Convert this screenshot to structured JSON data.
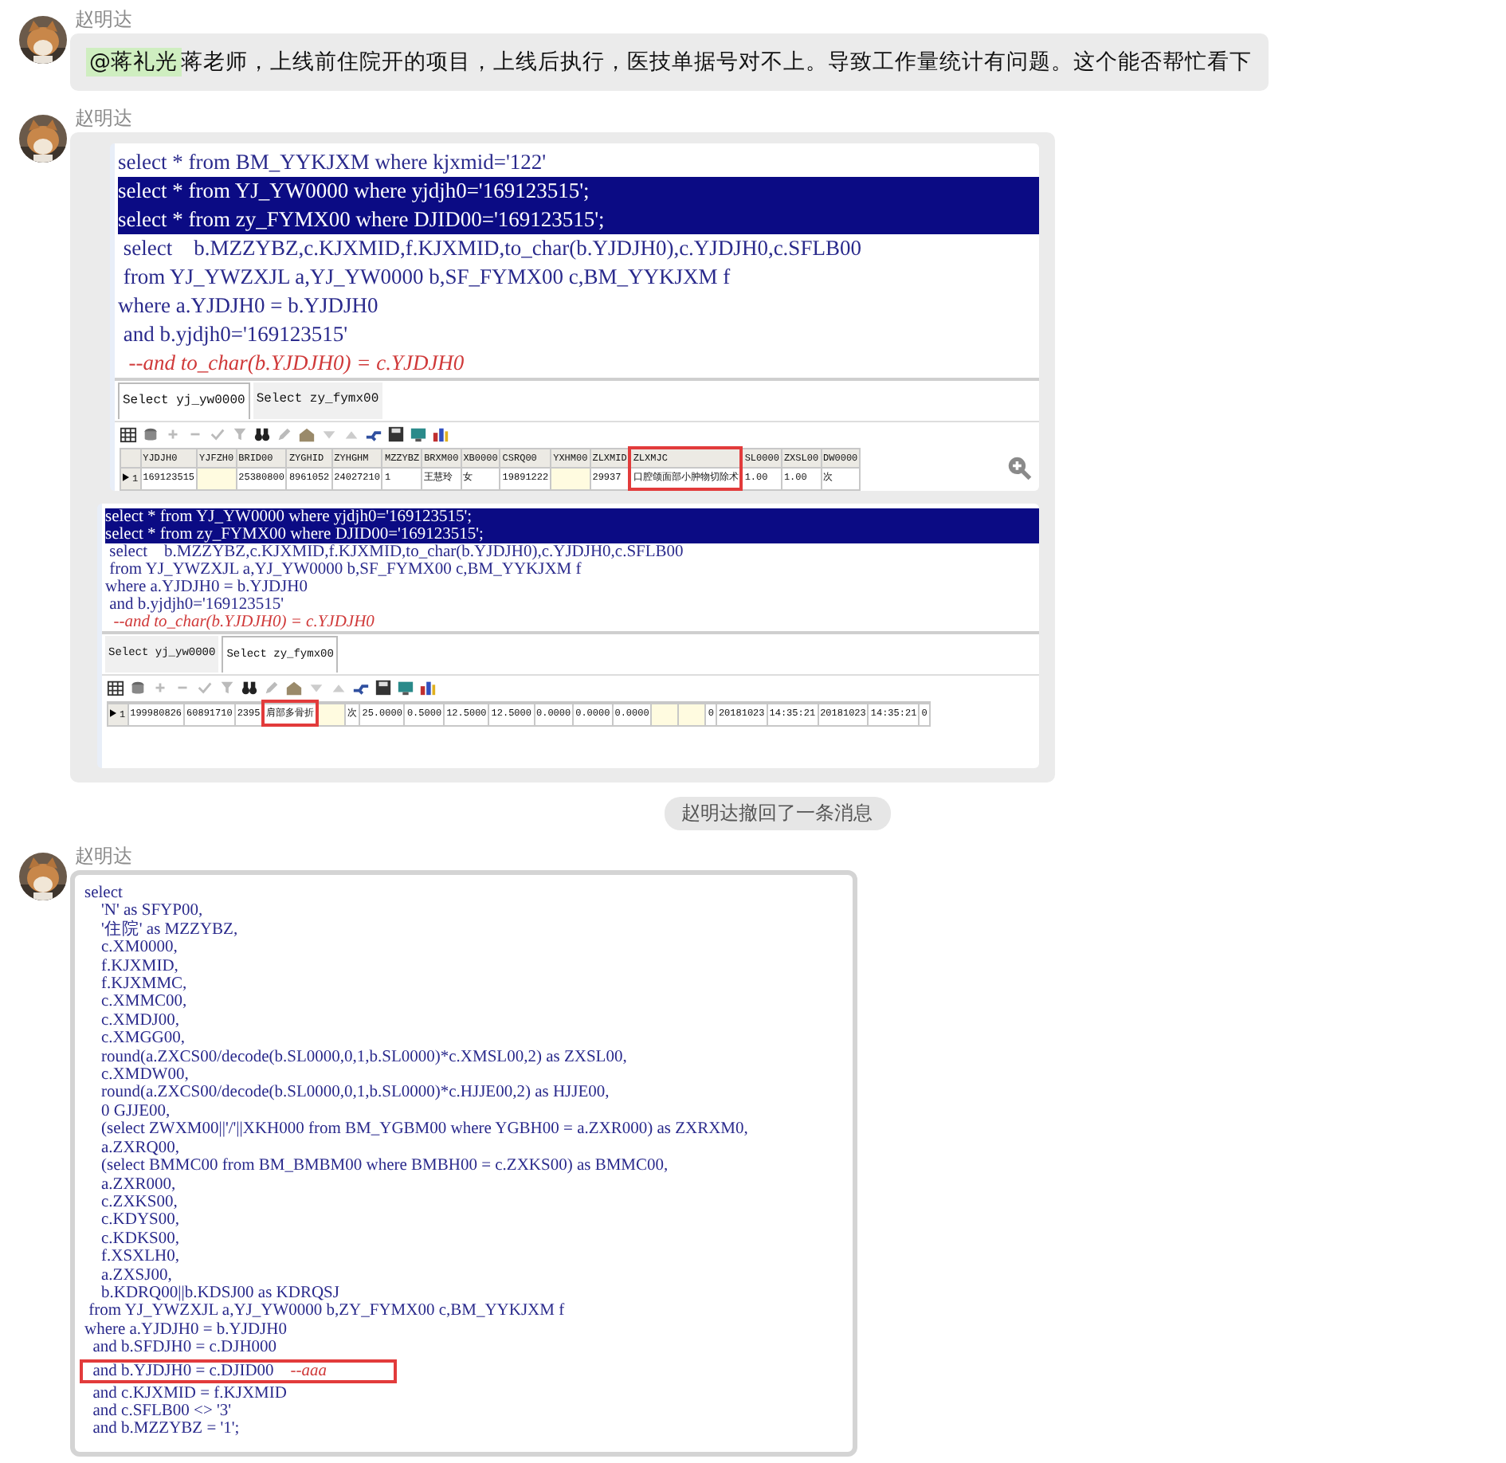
{
  "messages": [
    {
      "kind": "text",
      "sender": "赵明达",
      "mention": "@蒋礼光",
      "text": "蒋老师，上线前住院开的项目，上线后执行，医技单据号对不上。导致工作量统计有问题。这个能否帮忙看下"
    },
    {
      "kind": "images",
      "sender": "赵明达",
      "images": [
        {
          "kind": "large",
          "zoom_icon": true,
          "code_lines": [
            {
              "code": "select * from BM_YYKJXM where kjxmid='122'",
              "selected": false
            },
            {
              "code": "select * from YJ_YW0000 where yjdjh0='169123515';",
              "selected": true
            },
            {
              "code": "select * from zy_FYMX00 where DJID00='169123515';",
              "selected": true
            },
            {
              "code": " select    b.MZZYBZ,c.KJXMID,f.KJXMID,to_char(b.YJDJH0),c.YJDJH0,c.SFLB00",
              "selected": false
            },
            {
              "code": " from YJ_YWZXJL a,YJ_YW0000 b,SF_FYMX00 c,BM_YYKJXM f",
              "selected": false
            },
            {
              "code": "where a.YJDJH0 = b.YJDJH0",
              "selected": false
            },
            {
              "code": " and b.yjdjh0='169123515'",
              "selected": false
            },
            {
              "comment": "  --and to_char(b.YJDJH0) = c.YJDJH0",
              "selected": false
            }
          ],
          "tabs": [
            {
              "label": "Select yj_yw0000",
              "selected": true
            },
            {
              "label": "Select zy_fymx00",
              "selected": false
            }
          ],
          "grid": {
            "columns": [
              {
                "name": "YJDJH0",
                "marked": false
              },
              {
                "name": "YJFZH0",
                "marked": false
              },
              {
                "name": "BRID00",
                "marked": false
              },
              {
                "name": "ZYGHID",
                "marked": false
              },
              {
                "name": "ZYHGHM",
                "marked": false
              },
              {
                "name": "MZZYBZ",
                "marked": false
              },
              {
                "name": "BRXM00",
                "marked": false
              },
              {
                "name": "XB0000",
                "marked": false
              },
              {
                "name": "CSRQ00",
                "marked": false
              },
              {
                "name": "YXHM00",
                "marked": false
              },
              {
                "name": "ZLXMID",
                "marked": false
              },
              {
                "name": "ZLXMJC",
                "marked": true
              },
              {
                "name": "SL0000",
                "marked": false
              },
              {
                "name": "ZXSL00",
                "marked": false
              },
              {
                "name": "DW0000",
                "marked": false
              }
            ],
            "rows": [
              {
                "number": "1",
                "cells": [
                  "169123515",
                  null,
                  "25380800",
                  "8961052",
                  "24027210",
                  "1",
                  "王慧玲",
                  "女",
                  "19891222",
                  null,
                  "29937",
                  "口腔颌面部小肿物切除术",
                  "1.00",
                  "1.00",
                  "次"
                ]
              }
            ]
          }
        },
        {
          "kind": "small",
          "code_lines": [
            {
              "code": "select * from YJ_YW0000 where yjdjh0='169123515';",
              "selected": true
            },
            {
              "code": "select * from zy_FYMX00 where DJID00='169123515';",
              "selected": true
            },
            {
              "code": " select    b.MZZYBZ,c.KJXMID,f.KJXMID,to_char(b.YJDJH0),c.YJDJH0,c.SFLB00",
              "selected": false
            },
            {
              "code": " from YJ_YWZXJL a,YJ_YW0000 b,SF_FYMX00 c,BM_YYKJXM f",
              "selected": false
            },
            {
              "code": "where a.YJDJH0 = b.YJDJH0",
              "selected": false
            },
            {
              "code": " and b.yjdjh0='169123515'",
              "selected": false
            },
            {
              "comment": "  --and to_char(b.YJDJH0) = c.YJDJH0",
              "selected": false
            }
          ],
          "tabs": [
            {
              "label": "Select yj_yw0000",
              "selected": false
            },
            {
              "label": "Select zy_fymx00",
              "selected": true
            }
          ],
          "grid": {
            "columns": [
              {
                "marked": false
              },
              {
                "marked": false
              },
              {
                "marked": false
              },
              {
                "marked": true
              },
              {
                "marked": false
              },
              {
                "marked": false
              },
              {
                "marked": false
              },
              {
                "marked": false
              },
              {
                "marked": false
              },
              {
                "marked": false
              },
              {
                "marked": false
              },
              {
                "marked": false
              },
              {
                "marked": false
              },
              {
                "marked": false
              },
              {
                "marked": false
              },
              {
                "marked": false
              },
              {
                "marked": false
              },
              {
                "marked": false
              },
              {
                "marked": false
              },
              {
                "marked": false
              },
              {
                "marked": false
              }
            ],
            "rows": [
              {
                "number": "1",
                "cells": [
                  "199980826",
                  "60891710",
                  "2395",
                  "肩部多骨折",
                  null,
                  "次",
                  "25.0000",
                  "0.5000",
                  "12.5000",
                  "12.5000",
                  "0.0000",
                  "0.0000",
                  "0.0000",
                  null,
                  null,
                  "0",
                  "20181023",
                  "14:35:21",
                  "20181023",
                  "14:35:21",
                  "0"
                ]
              }
            ]
          }
        }
      ]
    },
    {
      "kind": "notice",
      "text": "赵明达撤回了一条消息"
    },
    {
      "kind": "code_image",
      "sender": "赵明达",
      "code_lines": [
        {
          "code": "select",
          "boxed": false
        },
        {
          "code": "    'N' as SFYP00,",
          "boxed": false
        },
        {
          "code": "    '住院' as MZZYBZ,",
          "boxed": false
        },
        {
          "code": "    c.XM0000,",
          "boxed": false
        },
        {
          "code": "    f.KJXMID,",
          "boxed": false
        },
        {
          "code": "    f.KJXMMC,",
          "boxed": false
        },
        {
          "code": "    c.XMMC00,",
          "boxed": false
        },
        {
          "code": "    c.XMDJ00,",
          "boxed": false
        },
        {
          "code": "    c.XMGG00,",
          "boxed": false
        },
        {
          "code": "    round(a.ZXCS00/decode(b.SL0000,0,1,b.SL0000)*c.XMSL00,2) as ZXSL00,",
          "boxed": false
        },
        {
          "code": "    c.XMDW00,",
          "boxed": false
        },
        {
          "code": "    round(a.ZXCS00/decode(b.SL0000,0,1,b.SL0000)*c.HJJE00,2) as HJJE00,",
          "boxed": false
        },
        {
          "code": "    0 GJJE00,",
          "boxed": false
        },
        {
          "code": "    (select ZWXM00||'/'||XKH000 from BM_YGBM00 where YGBH00 = a.ZXR000) as ZXRXM0,",
          "boxed": false
        },
        {
          "code": "    a.ZXRQ00,",
          "boxed": false
        },
        {
          "code": "    (select BMMC00 from BM_BMBM00 where BMBH00 = c.ZXKS00) as BMMC00,",
          "boxed": false
        },
        {
          "code": "    a.ZXR000,",
          "boxed": false
        },
        {
          "code": "    c.ZXKS00,",
          "boxed": false
        },
        {
          "code": "    c.KDYS00,",
          "boxed": false
        },
        {
          "code": "    c.KDKS00,",
          "boxed": false
        },
        {
          "code": "    f.XSXLH0,",
          "boxed": false
        },
        {
          "code": "    a.ZXSJ00,",
          "boxed": false
        },
        {
          "code": "    b.KDRQ00||b.KDSJ00 as KDRQSJ",
          "boxed": false
        },
        {
          "code": " from YJ_YWZXJL a,YJ_YW0000 b,ZY_FYMX00 c,BM_YYKJXM f",
          "boxed": false
        },
        {
          "code": "where a.YJDJH0 = b.YJDJH0",
          "boxed": false
        },
        {
          "code": "  and b.SFDJH0 = c.DJH000",
          "boxed": false
        },
        {
          "code": "  and b.YJDJH0 = c.DJID00    ",
          "comment": "--aaa",
          "boxed": true
        },
        {
          "code": "  and c.KJXMID = f.KJXMID",
          "boxed": false
        },
        {
          "code": "  and c.SFLB00 <> '3'",
          "boxed": false
        },
        {
          "code": "  and b.MZZYBZ = '1';",
          "boxed": false
        }
      ]
    }
  ]
}
